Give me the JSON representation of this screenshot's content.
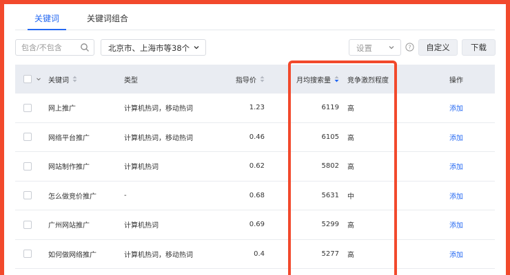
{
  "tabs": [
    {
      "label": "关键词",
      "active": true
    },
    {
      "label": "关键词组合",
      "active": false
    }
  ],
  "toolbar": {
    "search_placeholder": "包含/不包含",
    "region_value": "北京市、上海市等38个",
    "settings_placeholder": "设置",
    "custom_label": "自定义",
    "download_label": "下载"
  },
  "table": {
    "headers": {
      "keyword": "关键词",
      "type": "类型",
      "price": "指导价",
      "monthly_search": "月均搜索量",
      "competition": "竞争激烈程度",
      "action": "操作"
    },
    "rows": [
      {
        "keyword": "网上推广",
        "type": "计算机热词，移动热词",
        "price": "1.23",
        "search": "6119",
        "competition": "高",
        "action": "添加"
      },
      {
        "keyword": "网络平台推广",
        "type": "计算机热词，移动热词",
        "price": "0.46",
        "search": "6105",
        "competition": "高",
        "action": "添加"
      },
      {
        "keyword": "网站制作推广",
        "type": "计算机热词",
        "price": "0.62",
        "search": "5802",
        "competition": "高",
        "action": "添加"
      },
      {
        "keyword": "怎么做竞价推广",
        "type": "-",
        "price": "0.68",
        "search": "5631",
        "competition": "中",
        "action": "添加"
      },
      {
        "keyword": "广州网站推广",
        "type": "计算机热词",
        "price": "0.69",
        "search": "5299",
        "competition": "高",
        "action": "添加"
      },
      {
        "keyword": "如何做网络推广",
        "type": "计算机热词，移动热词",
        "price": "0.4",
        "search": "5277",
        "competition": "高",
        "action": "添加"
      }
    ]
  },
  "colors": {
    "accent": "#2468f2",
    "highlight": "#f2492c",
    "header_bg": "#e9ecf2"
  },
  "icons": {
    "search": "search-icon",
    "chevron": "chevron-down-icon",
    "help": "help-circle-icon",
    "sort": "sort-icon"
  }
}
